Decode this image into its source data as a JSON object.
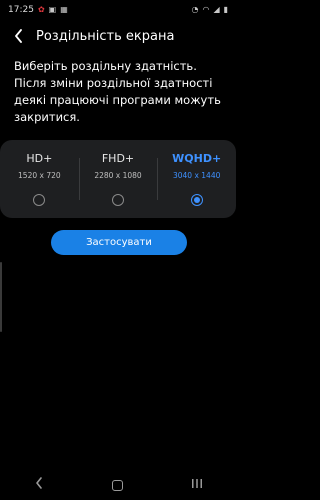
{
  "status_bar": {
    "time": "17:25",
    "icons": [
      "huawei-app-icon",
      "gallery-icon",
      "image-icon",
      "alarm-icon",
      "wifi-icon",
      "signal-icon",
      "battery-icon"
    ]
  },
  "header": {
    "title": "Роздільність екрана",
    "back_icon": "chevron-left-icon"
  },
  "description": "Виберіть роздільну здатність. Після зміни роздільної здатності деякі працюючі програми можуть закритися.",
  "options": [
    {
      "name": "HD+",
      "resolution": "1520 x 720",
      "selected": false
    },
    {
      "name": "FHD+",
      "resolution": "2280 x 1080",
      "selected": false
    },
    {
      "name": "WQHD+",
      "resolution": "3040 x 1440",
      "selected": true
    }
  ],
  "apply_label": "Застосувати",
  "colors": {
    "accent": "#3e91ff",
    "button": "#1a81e6",
    "card": "#1e1f21",
    "background": "#000000"
  },
  "nav": {
    "back": "back-icon",
    "home": "home-icon",
    "recents": "recents-icon"
  }
}
